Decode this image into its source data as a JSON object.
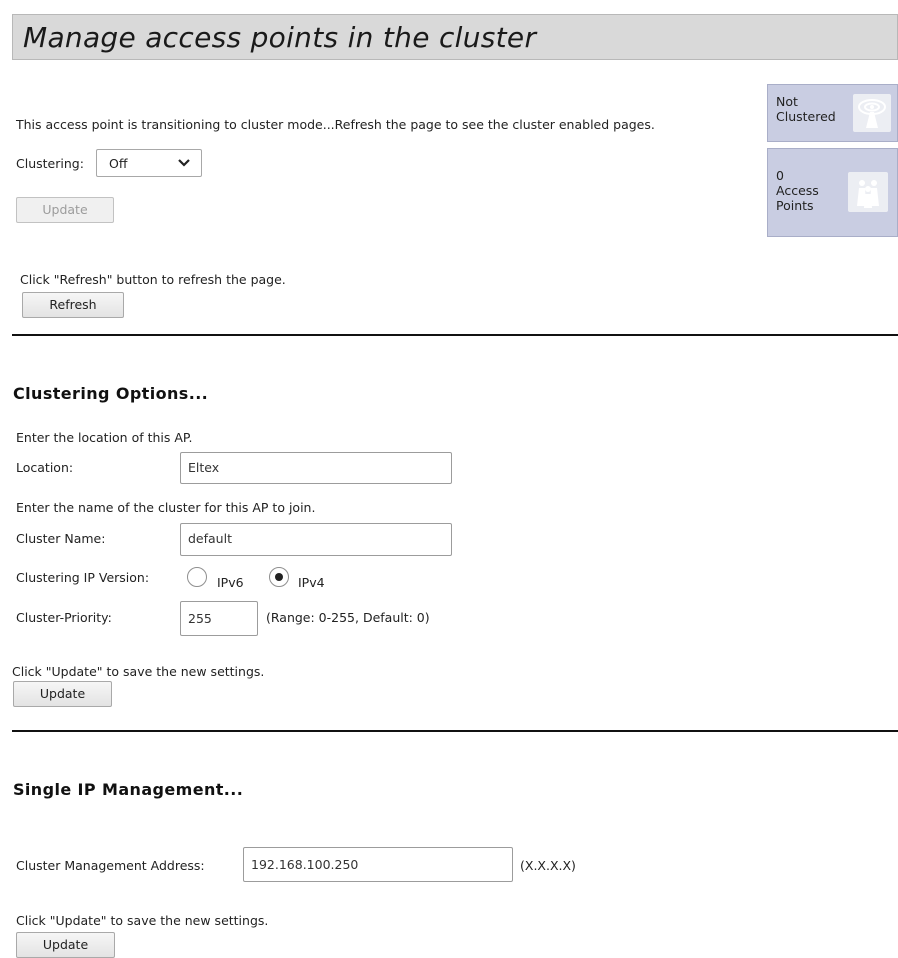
{
  "page": {
    "title": "Manage access points in the cluster"
  },
  "status": {
    "transition_msg": "This access point is transitioning to cluster mode...Refresh the page to see the cluster enabled pages.",
    "cluster_state_line1": "Not",
    "cluster_state_line2": "Clustered",
    "ap_count": "0",
    "ap_label_line1": "Access",
    "ap_label_line2": "Points"
  },
  "clustering": {
    "label": "Clustering:",
    "value": "Off",
    "update_label": "Update"
  },
  "refresh": {
    "hint": "Click \"Refresh\" button to refresh the page.",
    "button_label": "Refresh"
  },
  "options": {
    "heading": "Clustering Options...",
    "location_hint": "Enter the location of this AP.",
    "location_label": "Location:",
    "location_value": "Eltex",
    "cluster_name_hint": "Enter the name of the cluster for this AP to join.",
    "cluster_name_label": "Cluster Name:",
    "cluster_name_value": "default",
    "ip_version_label": "Clustering IP Version:",
    "ipv6_label": "IPv6",
    "ipv4_label": "IPv4",
    "priority_label": "Cluster-Priority:",
    "priority_value": "255",
    "priority_range": "(Range: 0-255, Default: 0)",
    "update_hint": "Click \"Update\" to save the new settings.",
    "update_label": "Update"
  },
  "single_ip": {
    "heading": "Single IP Management...",
    "address_label": "Cluster Management Address:",
    "address_value": "192.168.100.250",
    "address_format": "(X.X.X.X)",
    "update_hint": "Click \"Update\" to save the new settings.",
    "update_label": "Update"
  },
  "icons": {
    "cluster_state": "antenna-icon",
    "access_points": "people-icon"
  },
  "colors": {
    "status_box_bg": "#c9cde2",
    "title_bg": "#d9d9d9"
  }
}
